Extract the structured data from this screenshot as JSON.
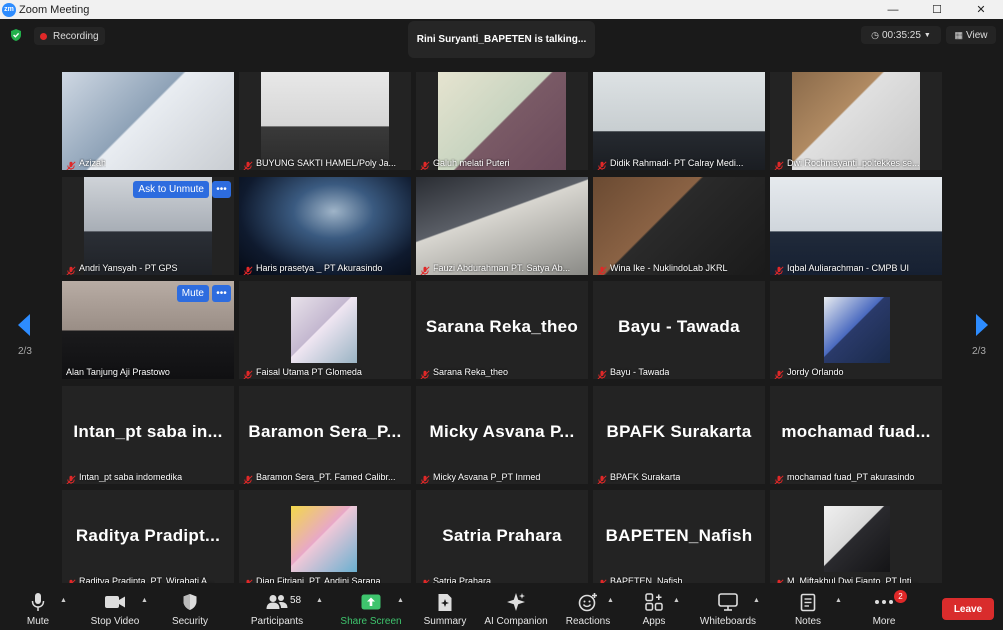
{
  "window": {
    "title": "Zoom Meeting",
    "logo": "zm",
    "controls": [
      "—",
      "☐",
      "✕"
    ]
  },
  "top": {
    "recording_label": "Recording",
    "talking": "Rini Suryanti_BAPETEN is talking...",
    "timer": "00:35:25",
    "view_label": "View"
  },
  "paging": {
    "left": "2/3",
    "right": "2/3"
  },
  "tiles": [
    {
      "name": "Azizah",
      "video": true,
      "muted": true
    },
    {
      "name": "BUYUNG SAKTI HAMEL/Poly Ja...",
      "video": true,
      "muted": true
    },
    {
      "name": "Galuh melati Puteri",
      "video": true,
      "muted": true
    },
    {
      "name": "Didik Rahmadi- PT Calray Medi...",
      "video": true,
      "muted": true
    },
    {
      "name": "Dwi Rochmayanti_poltekkes se...",
      "video": true,
      "muted": true
    },
    {
      "name": "Andri Yansyah - PT GPS",
      "video": true,
      "muted": true,
      "pill": "Ask to Unmute"
    },
    {
      "name": "Haris prasetya _ PT Akurasindo",
      "video": true,
      "muted": true
    },
    {
      "name": "Fauzi Abdurahman PT. Satya Ab...",
      "video": true,
      "muted": true
    },
    {
      "name": "Wina Ike - NuklindoLab JKRL",
      "video": true,
      "muted": true
    },
    {
      "name": "Iqbal Auliarachman - CMPB UI",
      "video": true,
      "muted": true
    },
    {
      "name": "Alan Tanjung Aji Prastowo",
      "video": true,
      "muted": false,
      "pill": "Mute"
    },
    {
      "name": "Faisal Utama PT Glomeda",
      "video": false,
      "photo": true,
      "muted": true
    },
    {
      "name": "Sarana Reka_theo",
      "big": "Sarana Reka_theo",
      "muted": true
    },
    {
      "name": "Bayu - Tawada",
      "big": "Bayu - Tawada",
      "muted": true
    },
    {
      "name": "Jordy Orlando",
      "video": false,
      "photo": true,
      "muted": true
    },
    {
      "name": "Intan_pt saba indomedika",
      "big": "Intan_pt saba in...",
      "muted": true
    },
    {
      "name": "Baramon Sera_PT. Famed Calibr...",
      "big": "Baramon Sera_P...",
      "muted": true
    },
    {
      "name": "Micky Asvana P_PT Inmed",
      "big": "Micky Asvana P...",
      "muted": true
    },
    {
      "name": "BPAFK Surakarta",
      "big": "BPAFK Surakarta",
      "muted": true
    },
    {
      "name": "mochamad fuad_PT akurasindo",
      "big": "mochamad fuad...",
      "muted": true
    },
    {
      "name": "Raditya Pradipta_PT. Wirabati A...",
      "big": "Raditya Pradipt...",
      "muted": true
    },
    {
      "name": "Dian Fitriani_PT. Andini Sarana",
      "video": false,
      "photo": true,
      "muted": true
    },
    {
      "name": "Satria Prahara",
      "big": "Satria Prahara",
      "muted": true
    },
    {
      "name": "BAPETEN_Nafish",
      "big": "BAPETEN_Nafish",
      "muted": true
    },
    {
      "name": "M. Miftakhul Dwi Fianto_PT Inti...",
      "video": false,
      "photo": true,
      "muted": true
    }
  ],
  "toolbar": {
    "mute": "Mute",
    "stop_video": "Stop Video",
    "security": "Security",
    "participants": "Participants",
    "participant_count": "58",
    "share_screen": "Share Screen",
    "summary": "Summary",
    "ai_companion": "AI Companion",
    "reactions": "Reactions",
    "apps": "Apps",
    "whiteboards": "Whiteboards",
    "notes": "Notes",
    "more": "More",
    "more_badge": "2",
    "leave": "Leave"
  },
  "colors": {
    "accent": "#2d8cff",
    "leave": "#d92c2c",
    "share": "#3ec46d",
    "mute_red": "#e02828"
  }
}
